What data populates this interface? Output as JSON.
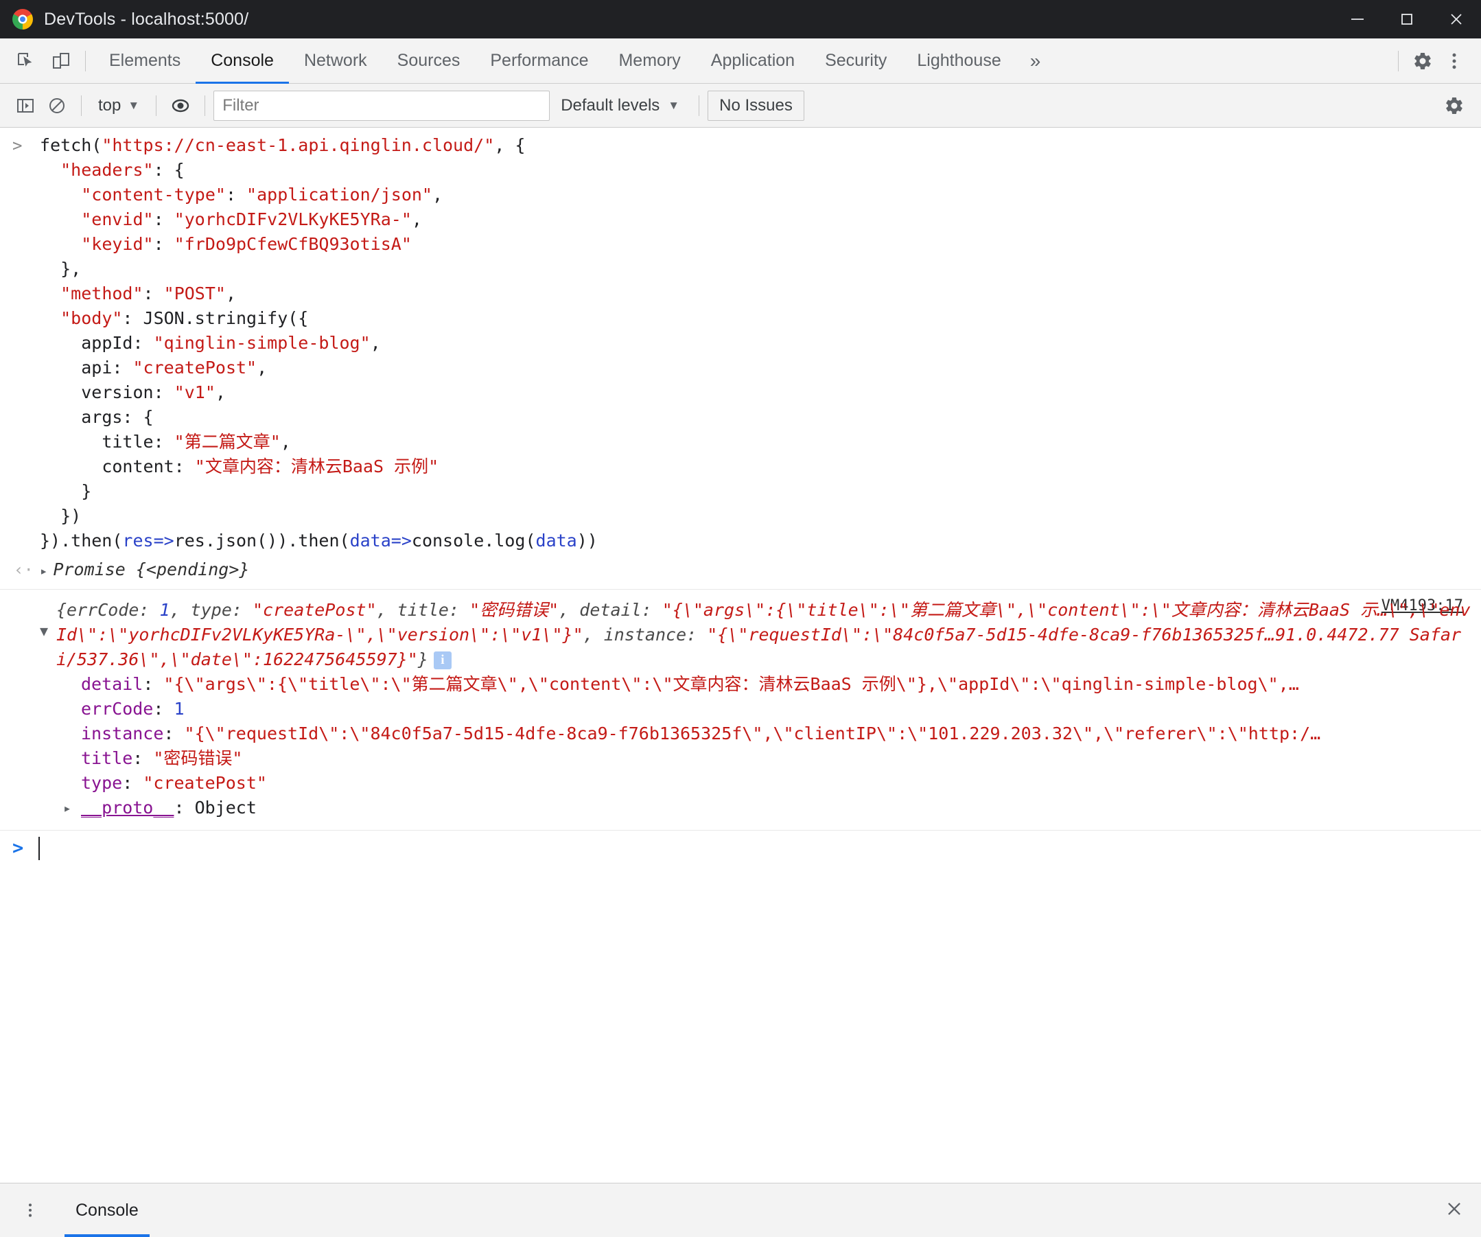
{
  "window": {
    "title": "DevTools - localhost:5000/",
    "logo_icon": "chrome-logo-icon",
    "minimize_icon": "minimize-icon",
    "maximize_icon": "maximize-icon",
    "close_icon": "close-icon"
  },
  "toolbar": {
    "inspect_icon": "inspect-element-icon",
    "device_icon": "device-toolbar-icon",
    "overflow_label": "»",
    "settings_icon": "gear-icon",
    "more_icon": "more-vertical-icon",
    "tabs": [
      {
        "label": "Elements",
        "active": false
      },
      {
        "label": "Console",
        "active": true
      },
      {
        "label": "Network",
        "active": false
      },
      {
        "label": "Sources",
        "active": false
      },
      {
        "label": "Performance",
        "active": false
      },
      {
        "label": "Memory",
        "active": false
      },
      {
        "label": "Application",
        "active": false
      },
      {
        "label": "Security",
        "active": false
      },
      {
        "label": "Lighthouse",
        "active": false
      }
    ]
  },
  "filterbar": {
    "sidebar_icon": "show-console-sidebar-icon",
    "clear_icon": "clear-console-icon",
    "context": "top",
    "context_caret": "▼",
    "eye_icon": "live-expression-icon",
    "filter_value": "",
    "filter_placeholder": "Filter",
    "levels_label": "Default levels",
    "levels_caret": "▼",
    "issues_label": "No Issues",
    "settings_icon": "console-settings-gear-icon"
  },
  "console": {
    "input_prompt": ">",
    "code": {
      "line1_a": "fetch(",
      "line1_url": "\"https://cn-east-1.api.qinglin.cloud/\"",
      "line1_b": ", {",
      "line2_key": "\"headers\"",
      "line2_rest": ": {",
      "line3_key": "\"content-type\"",
      "line3_val": "\"application/json\"",
      "line4_key": "\"envid\"",
      "line4_val": "\"yorhcDIFv2VLKyKE5YRa-\"",
      "line5_key": "\"keyid\"",
      "line5_val": "\"frDo9pCfewCfBQ93otisA\"",
      "line6": "},",
      "line7_key": "\"method\"",
      "line7_val": "\"POST\"",
      "line8_key": "\"body\"",
      "line8_rest": ": JSON.stringify({",
      "line9_key": "appId: ",
      "line9_val": "\"qinglin-simple-blog\"",
      "line10_key": "api: ",
      "line10_val": "\"createPost\"",
      "line11_key": "version: ",
      "line11_val": "\"v1\"",
      "line12": "args: {",
      "line13_key": "title: ",
      "line13_val": "\"第二篇文章\"",
      "line14_key": "content: ",
      "line14_val": "\"文章内容：清林云BaaS 示例\"",
      "line15": "}",
      "line16": "})",
      "line17_a": "}).then(",
      "line17_res": "res",
      "line17_b": "=>",
      "line17_res2": "res",
      "line17_c": ".json()).then(",
      "line17_data": "data",
      "line17_d": "=>",
      "line17_e": "console.log(",
      "line17_data2": "data",
      "line17_f": "))"
    },
    "result": {
      "arrow": "‹·",
      "disclosure": "▸",
      "text": "Promise {<pending>}"
    },
    "object_log": {
      "vm_link": "VM4193:17",
      "disclosure": "▼",
      "preview_prefix": "{errCode: ",
      "preview_errcode": "1",
      "preview_rest_1": ", type: ",
      "preview_type": "\"createPost\"",
      "preview_rest_2": ", title: ",
      "preview_title": "\"密码错误\"",
      "preview_rest_3": ", detail: ",
      "preview_detail": "\"{\\\"args\\\":{\\\"title\\\":\\\"第二篇文章\\\",\\\"content\\\":\\\"文章内容：清林云BaaS 示…\\\",\\\"envId\\\":\\\"yorhcDIFv2VLKyKE5YRa-\\\",\\\"version\\\":\\\"v1\\\"}\"",
      "preview_rest_4": ", instance: ",
      "preview_instance": "\"{\\\"requestId\\\":\\\"84c0f5a7-5d15-4dfe-8ca9-f76b1365325f…91.0.4472.77 Safari/537.36\\\",\\\"date\\\":1622475645597}\"",
      "preview_suffix": "}",
      "info_badge": "i",
      "properties": [
        {
          "key": "detail",
          "value": "\"{\\\"args\\\":{\\\"title\\\":\\\"第二篇文章\\\",\\\"content\\\":\\\"文章内容：清林云BaaS 示例\\\"},\\\"appId\\\":\\\"qinglin-simple-blog\\\",…",
          "kind": "string"
        },
        {
          "key": "errCode",
          "value": "1",
          "kind": "number"
        },
        {
          "key": "instance",
          "value": "\"{\\\"requestId\\\":\\\"84c0f5a7-5d15-4dfe-8ca9-f76b1365325f\\\",\\\"clientIP\\\":\\\"101.229.203.32\\\",\\\"referer\\\":\\\"http:/…",
          "kind": "string"
        },
        {
          "key": "title",
          "value": "\"密码错误\"",
          "kind": "string"
        },
        {
          "key": "type",
          "value": "\"createPost\"",
          "kind": "string"
        }
      ],
      "proto_key": "__proto__",
      "proto_sep": ": ",
      "proto_value": "Object",
      "proto_disclosure": "▸"
    }
  },
  "drawer": {
    "menu_icon": "drawer-more-icon",
    "tab_label": "Console",
    "close_icon": "close-drawer-icon"
  },
  "colors": {
    "accent": "#1a73e8",
    "string": "#c41a16",
    "number": "#2a42c8",
    "property": "#881391",
    "titlebar_bg": "#202124",
    "toolbar_bg": "#f3f3f3"
  }
}
